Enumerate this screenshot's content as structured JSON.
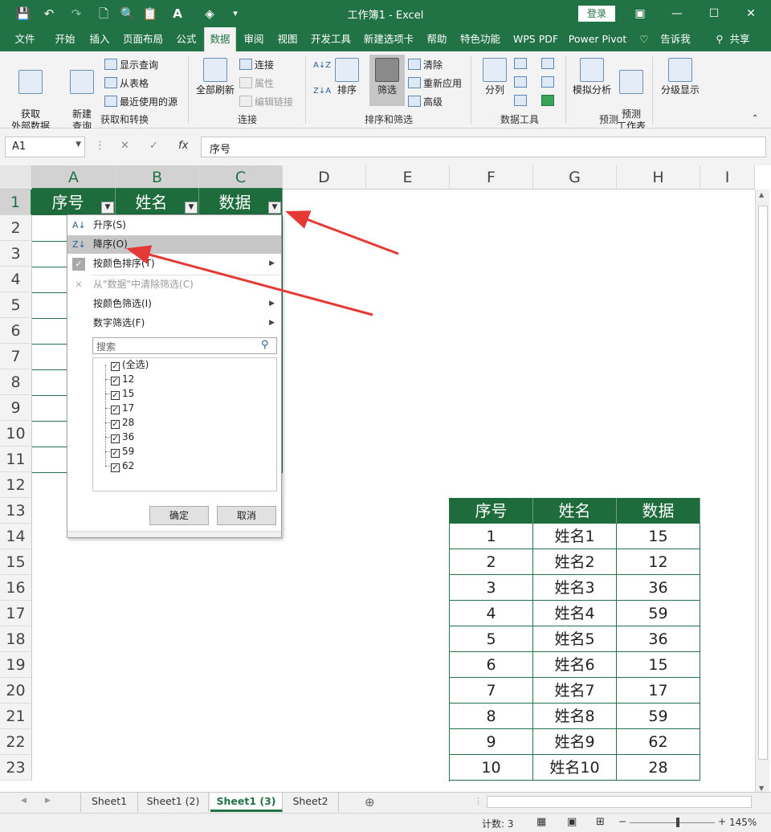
{
  "window": {
    "title": "工作簿1  -  Excel",
    "login": "登录"
  },
  "tabs": [
    "文件",
    "开始",
    "插入",
    "页面布局",
    "公式",
    "数据",
    "审阅",
    "视图",
    "开发工具",
    "新建选项卡",
    "帮助",
    "特色功能",
    "WPS PDF",
    "Power Pivot",
    "告诉我",
    "共享"
  ],
  "active_tab": "数据",
  "ribbon": {
    "get_data": "获取\n外部数据",
    "new_query": "新建\n查询",
    "show_queries": "显示查询",
    "from_table": "从表格",
    "recent_sources": "最近使用的源",
    "group_get_transform": "获取和转换",
    "refresh_all": "全部刷新",
    "connections": "连接",
    "properties": "属性",
    "edit_links": "编辑链接",
    "group_connections": "连接",
    "sort": "排序",
    "filter": "筛选",
    "clear": "清除",
    "reapply": "重新应用",
    "advanced": "高级",
    "group_sort_filter": "排序和筛选",
    "text_to_columns": "分列",
    "group_data_tools": "数据工具",
    "what_if": "模拟分析",
    "forecast_sheet": "预测\n工作表",
    "group_forecast": "预测",
    "outline": "分级显示"
  },
  "formula_bar": {
    "name_box": "A1",
    "formula": "序号"
  },
  "columns": [
    "A",
    "B",
    "C",
    "D",
    "E",
    "F",
    "G",
    "H",
    "I"
  ],
  "rows": [
    1,
    2,
    3,
    4,
    5,
    6,
    7,
    8,
    9,
    10,
    11,
    12,
    13,
    14,
    15,
    16,
    17,
    18,
    19,
    20,
    21,
    22,
    23
  ],
  "header_cells": [
    "序号",
    "姓名",
    "数据"
  ],
  "filter_menu": {
    "sort_asc": "升序(S)",
    "sort_desc": "降序(O)",
    "sort_by_color": "按颜色排序(T)",
    "clear_filter": "从\"数据\"中清除筛选(C)",
    "filter_by_color": "按颜色筛选(I)",
    "number_filters": "数字筛选(F)",
    "search_placeholder": "搜索",
    "items": [
      "(全选)",
      "12",
      "15",
      "17",
      "28",
      "36",
      "59",
      "62"
    ],
    "ok": "确定",
    "cancel": "取消"
  },
  "table": {
    "headers": [
      "序号",
      "姓名",
      "数据"
    ],
    "rows": [
      [
        "1",
        "姓名1",
        "15"
      ],
      [
        "2",
        "姓名2",
        "12"
      ],
      [
        "3",
        "姓名3",
        "36"
      ],
      [
        "4",
        "姓名4",
        "59"
      ],
      [
        "5",
        "姓名5",
        "36"
      ],
      [
        "6",
        "姓名6",
        "15"
      ],
      [
        "7",
        "姓名7",
        "17"
      ],
      [
        "8",
        "姓名8",
        "59"
      ],
      [
        "9",
        "姓名9",
        "62"
      ],
      [
        "10",
        "姓名10",
        "28"
      ]
    ]
  },
  "sheet_tabs": [
    "Sheet1",
    "Sheet1 (2)",
    "Sheet1 (3)",
    "Sheet2"
  ],
  "active_sheet": "Sheet1 (3)",
  "status": {
    "count": "计数: 3",
    "zoom": "145%"
  },
  "colors": {
    "accent": "#217346",
    "header_fill": "#1e6b3c",
    "arrow": "#e53935",
    "highlight": "#c6c6c6"
  }
}
